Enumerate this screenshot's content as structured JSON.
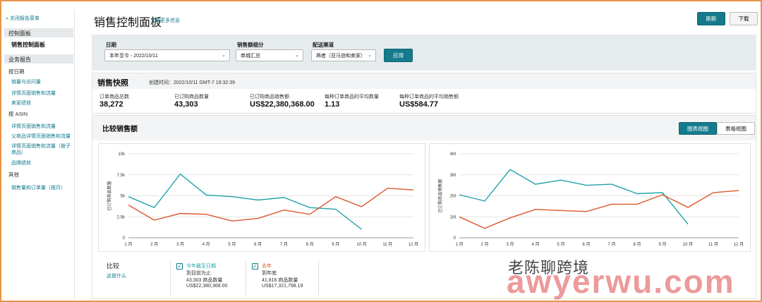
{
  "sidebar": {
    "close_label": "« 关闭报告菜单",
    "section1": "控制面板",
    "selected": "销售控制面板",
    "section2": "业务报告",
    "by_date": "按日期",
    "date_links": [
      "销量与访问量",
      "详情页面销售和流量",
      "卖家绩效"
    ],
    "by_asin": "按 ASIN",
    "asin_links": [
      "详情页面销售和流量",
      "父商品详情页面销售和流量",
      "详情页面销售和流量（按子商品）",
      "品牌绩效"
    ],
    "other": "其他",
    "other_links": [
      "销售量和订单量（按月）"
    ]
  },
  "header": {
    "title": "销售控制面板",
    "learn_more": "了解更多信息",
    "refresh": "刷新",
    "download": "下载"
  },
  "filters": {
    "date_label": "日期",
    "date_value": "本年至今 - 2022/10/11",
    "breakdown_label": "销售额细分",
    "breakdown_value": "商城汇总",
    "channel_label": "配送渠道",
    "channel_value": "两者（亚马逊和卖家）",
    "apply": "应用"
  },
  "snapshot": {
    "title": "销售快照",
    "created": "创建时间：2022/10/11 GMT-7 19:32:39",
    "metrics": [
      {
        "label": "订单商品总数",
        "value": "38,272"
      },
      {
        "label": "已订购商品数量",
        "value": "43,303"
      },
      {
        "label": "已订购商品销售额",
        "value": "US$22,380,368.00"
      },
      {
        "label": "每种订单商品的平均数量",
        "value": "1.13"
      },
      {
        "label": "每种订单商品的平均销售额",
        "value": "US$584.77"
      }
    ]
  },
  "compare": {
    "title": "比较销售额",
    "view_chart": "图表视图",
    "view_table": "表格视图",
    "compare_label": "比较",
    "what_is_this": "这是什么",
    "legend": [
      {
        "title": "今年截至日期",
        "line1": "到目前为止",
        "line2": "43,303 商品数量",
        "line3": "US$22,380,368.00",
        "color": "#21a3a9"
      },
      {
        "title": "去年",
        "line1": "到年底",
        "line2": "41,816 商品数量",
        "line3": "US$17,321,798.19",
        "color": "#d9582b"
      }
    ]
  },
  "watermark": {
    "logo_text": "老陈聊跨境",
    "site_text": "awyerwu.com"
  },
  "chart_data": [
    {
      "type": "line",
      "ylabel": "已订购商品数量",
      "categories": [
        "1 月",
        "2 月",
        "3 月",
        "4 月",
        "5 月",
        "6 月",
        "7 月",
        "8 月",
        "9 月",
        "10 月",
        "11 月",
        "12 月"
      ],
      "yticks": [
        "0",
        "2.5k",
        "5k",
        "7.5k",
        "10k"
      ],
      "ylim": [
        0,
        10000
      ],
      "series": [
        {
          "color": "#21a3a9",
          "values": [
            4900,
            3600,
            7600,
            5100,
            4900,
            4500,
            4800,
            3600,
            3400,
            1000,
            null,
            null
          ]
        },
        {
          "color": "#d9582b",
          "values": [
            3900,
            2100,
            2900,
            2800,
            2000,
            2300,
            3300,
            2800,
            4900,
            3700,
            5900,
            5700
          ]
        }
      ]
    },
    {
      "type": "line",
      "ylabel": "已订购商品销售额",
      "categories": [
        "1 月",
        "2 月",
        "3 月",
        "4 月",
        "5 月",
        "6 月",
        "7 月",
        "8 月",
        "9 月",
        "10 月",
        "11 月",
        "12 月"
      ],
      "yticks": [
        "0",
        "1M",
        "2M",
        "3M",
        "4M"
      ],
      "ylim": [
        0,
        4000000
      ],
      "series": [
        {
          "color": "#21a3a9",
          "values": [
            2050000,
            1750000,
            3250000,
            2550000,
            2750000,
            2500000,
            2550000,
            2100000,
            2150000,
            650000,
            null,
            null
          ]
        },
        {
          "color": "#d9582b",
          "values": [
            1000000,
            450000,
            950000,
            1350000,
            1300000,
            1250000,
            1600000,
            1600000,
            2050000,
            1450000,
            2150000,
            2250000
          ]
        }
      ]
    }
  ]
}
